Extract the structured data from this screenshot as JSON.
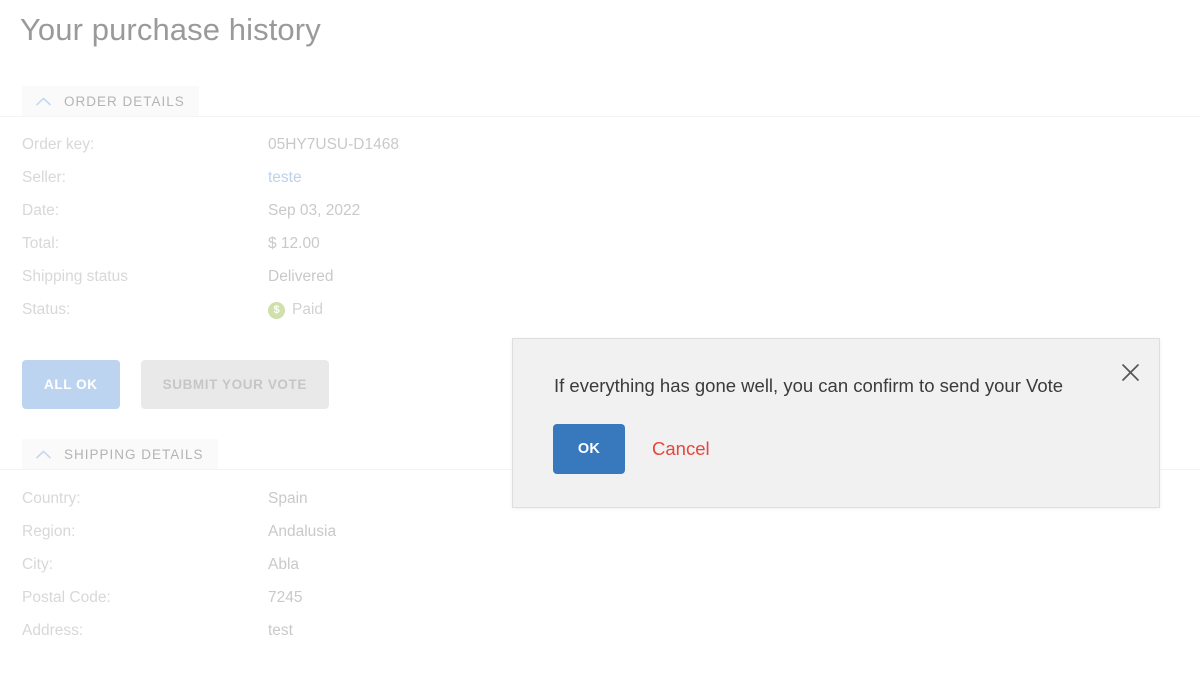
{
  "page": {
    "title": "Your purchase history"
  },
  "sections": [
    {
      "id": "order-details",
      "label": "ORDER DETAILS",
      "chevron_icon": "chevron-up-icon",
      "rows": [
        {
          "label": "Order key:",
          "value": "05HY7USU-D1468",
          "kind": "text"
        },
        {
          "label": "Seller:",
          "value": "teste",
          "kind": "link"
        },
        {
          "label": "Date:",
          "value": "Sep 03, 2022",
          "kind": "text"
        },
        {
          "label": "Total:",
          "value": "$ 12.00",
          "kind": "text"
        },
        {
          "label": "Shipping status",
          "value": "Delivered",
          "kind": "text"
        },
        {
          "label": "Status:",
          "value": "Paid",
          "kind": "badge",
          "badge_icon": "dollar-coin-icon",
          "badge_glyph": "$"
        }
      ]
    },
    {
      "id": "shipping-details",
      "label": "SHIPPING DETAILS",
      "chevron_icon": "chevron-up-icon",
      "rows": [
        {
          "label": "Country:",
          "value": "Spain",
          "kind": "text"
        },
        {
          "label": "Region:",
          "value": "Andalusia",
          "kind": "text"
        },
        {
          "label": "City:",
          "value": "Abla",
          "kind": "text"
        },
        {
          "label": "Postal Code:",
          "value": "7245",
          "kind": "text"
        },
        {
          "label": "Address:",
          "value": "test",
          "kind": "text"
        }
      ]
    }
  ],
  "actions": {
    "all_ok_label": "ALL OK",
    "submit_vote_label": "SUBMIT YOUR VOTE"
  },
  "modal": {
    "message": "If everything has gone well, you can confirm to send your Vote",
    "ok_label": "OK",
    "cancel_label": "Cancel",
    "close_icon": "close-icon"
  },
  "colors": {
    "accent_blue": "#3878bd",
    "all_ok_blue": "#bdd4f0",
    "cancel_red": "#e8453c",
    "paid_green": "#cfe0a9",
    "link_blue": "#bcd2ea",
    "muted_text": "#d8d8d8"
  }
}
